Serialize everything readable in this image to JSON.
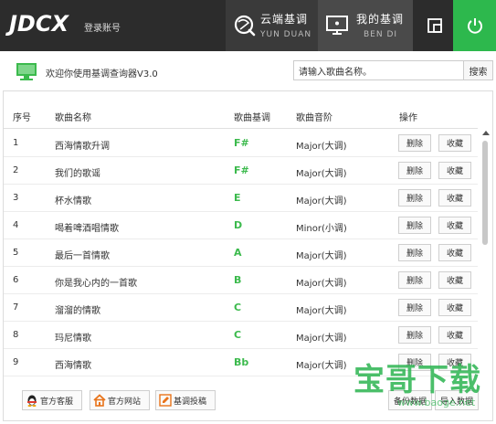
{
  "app": {
    "logo": "JDCX",
    "login_label": "登录账号",
    "tabs": [
      {
        "name": "云端基调",
        "sub": "YUN DUAN",
        "icon": "cloud-search-icon"
      },
      {
        "name": "我的基调",
        "sub": "BEN DI",
        "icon": "monitor-icon"
      }
    ],
    "mini_icon": "mini-mode-icon",
    "power_icon": "power-icon",
    "accent": "#2db84d"
  },
  "welcome": {
    "icon": "monitor-green-icon",
    "text": "欢迎你使用基调查询器V3.0"
  },
  "search": {
    "value": "请输入歌曲名称。",
    "button_label": "搜索"
  },
  "table": {
    "headers": [
      "序号",
      "歌曲名称",
      "歌曲基调",
      "歌曲音阶",
      "操作"
    ],
    "rows": [
      {
        "no": "1",
        "name": "西海情歌升调",
        "key": "F#",
        "scale": "Major(大调)"
      },
      {
        "no": "2",
        "name": "我们的歌谣",
        "key": "F#",
        "scale": "Major(大调)"
      },
      {
        "no": "3",
        "name": "杯水情歌",
        "key": "E",
        "scale": "Major(大调)"
      },
      {
        "no": "4",
        "name": "喝着啤酒唱情歌",
        "key": "D",
        "scale": "Minor(小调)"
      },
      {
        "no": "5",
        "name": "最后一首情歌",
        "key": "A",
        "scale": "Major(大调)"
      },
      {
        "no": "6",
        "name": "你是我心内的一首歌",
        "key": "B",
        "scale": "Major(大调)"
      },
      {
        "no": "7",
        "name": "溜溜的情歌",
        "key": "C",
        "scale": "Major(大调)"
      },
      {
        "no": "8",
        "name": "玛尼情歌",
        "key": "C",
        "scale": "Major(大调)"
      },
      {
        "no": "9",
        "name": "西海情歌",
        "key": "Bb",
        "scale": "Major(大调)"
      }
    ],
    "delete_label": "删除",
    "favorite_label": "收藏",
    "key_color": "#3cba4d"
  },
  "footer": {
    "buttons": [
      {
        "label": "官方客服",
        "icon": "penguin-icon"
      },
      {
        "label": "官方网站",
        "icon": "home-icon"
      },
      {
        "label": "基调投稿",
        "icon": "edit-icon"
      }
    ],
    "backup_label": "备份数据",
    "import_label": "导入数据"
  },
  "watermark": {
    "text": "宝哥下载",
    "url": "www.baoge.net"
  }
}
